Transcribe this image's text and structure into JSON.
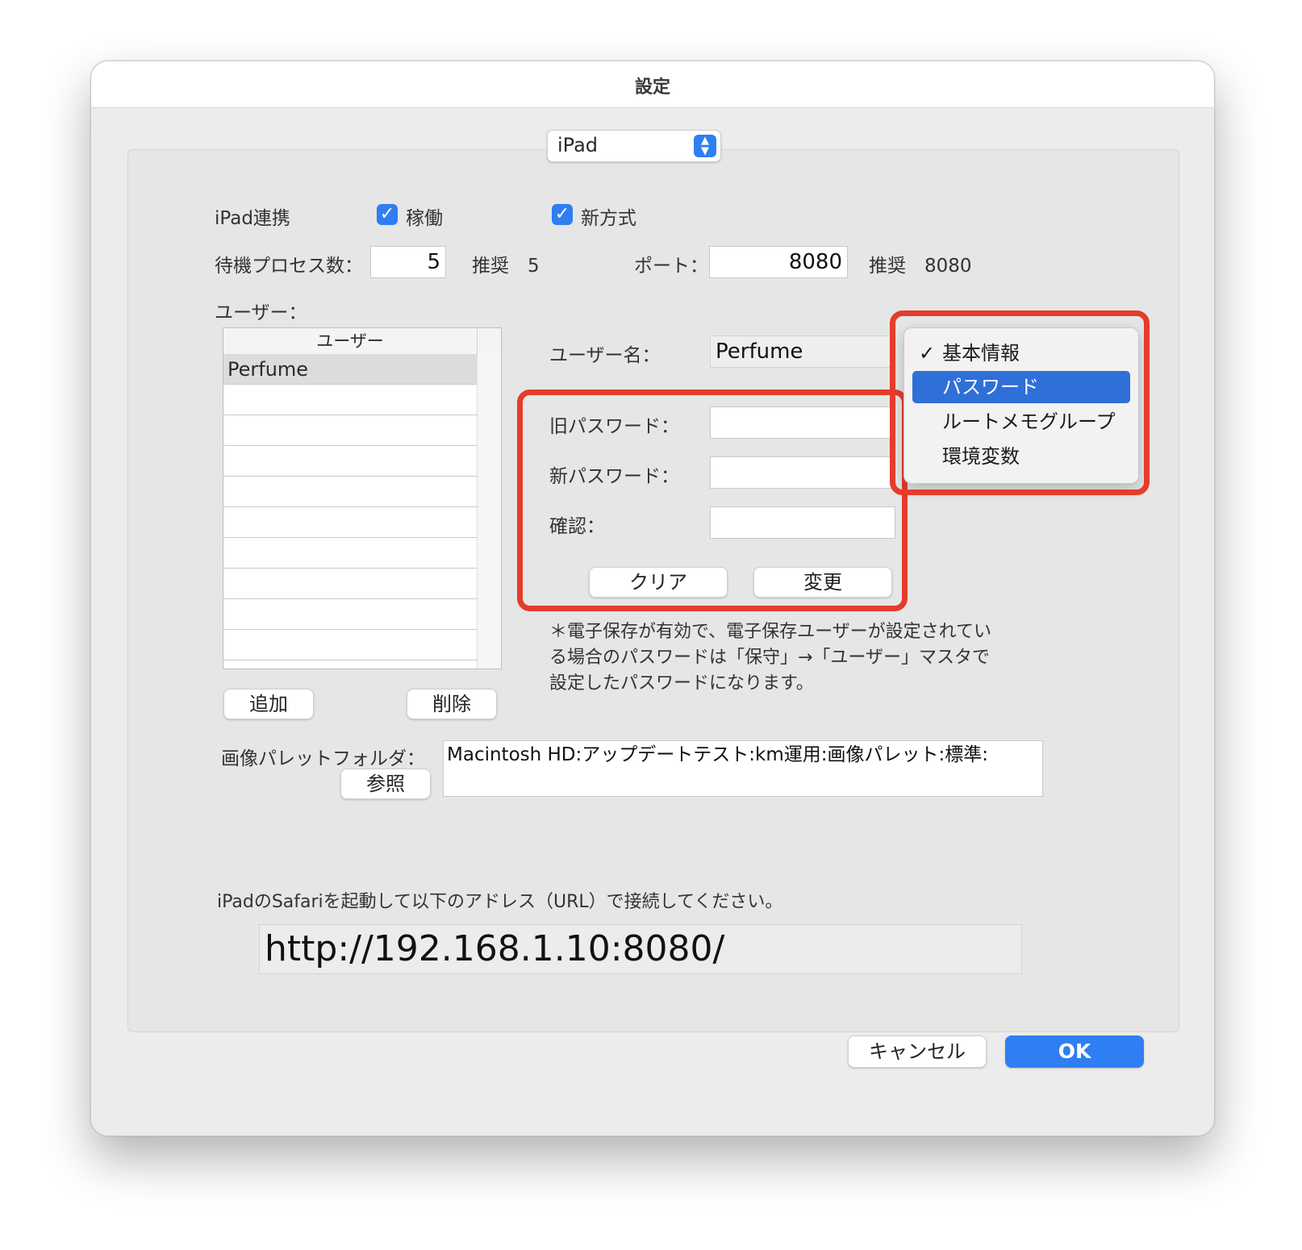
{
  "window": {
    "title": "設定"
  },
  "selector": {
    "value": "iPad"
  },
  "ipad_link": {
    "label": "iPad連携",
    "active_label": "稼働",
    "new_method_label": "新方式"
  },
  "process": {
    "label": "待機プロセス数：",
    "value": "5",
    "recommend": "推奨　5"
  },
  "port": {
    "label": "ポート：",
    "value": "8080",
    "recommend": "推奨　8080"
  },
  "users": {
    "section_label": "ユーザー：",
    "column_header": "ユーザー",
    "rows": [
      "Perfume"
    ],
    "add_label": "追加",
    "delete_label": "削除"
  },
  "username": {
    "label": "ユーザー名：",
    "value": "Perfume"
  },
  "password": {
    "old_label": "旧パスワード：",
    "new_label": "新パスワード：",
    "confirm_label": "確認：",
    "clear_label": "クリア",
    "change_label": "変更"
  },
  "menu": {
    "items": [
      "基本情報",
      "パスワード",
      "ルートメモグループ",
      "環境変数"
    ],
    "check_mark": "✓"
  },
  "note": {
    "line1": "＊電子保存が有効で、電子保存ユーザーが設定されてい",
    "line2": "る場合のパスワードは「保守」→「ユーザー」マスタで",
    "line3": "設定したパスワードになります。"
  },
  "palette": {
    "label": "画像パレットフォルダ：",
    "browse_label": "参照",
    "path": "Macintosh HD:アップデートテスト:km運用:画像パレット:標準:"
  },
  "connect": {
    "instruction": "iPadのSafariを起動して以下のアドレス（URL）で接続してください。",
    "url": "http://192.168.1.10:8080/"
  },
  "footer": {
    "cancel_label": "キャンセル",
    "ok_label": "OK"
  },
  "colors": {
    "accent": "#2f7ef3",
    "highlight": "#e53c2c"
  }
}
